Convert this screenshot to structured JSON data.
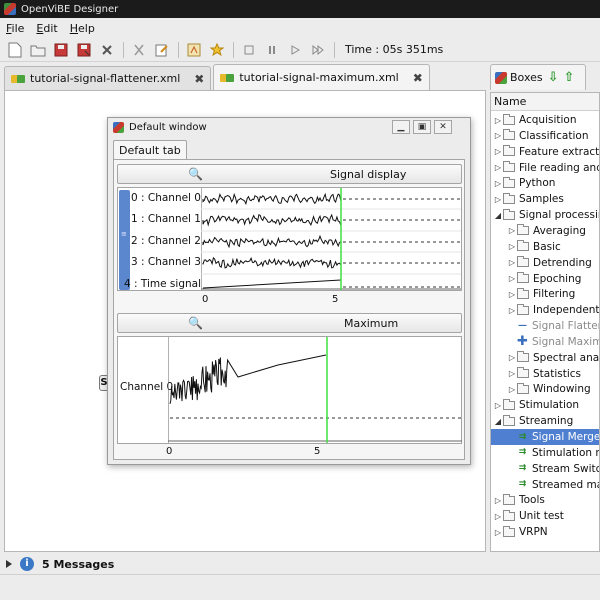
{
  "window": {
    "title": "OpenViBE Designer"
  },
  "menu": [
    "File",
    "Edit",
    "Help"
  ],
  "toolbar": {
    "time_label": "Time : 05s 351ms"
  },
  "tabs": [
    {
      "label": "tutorial-signal-flattener.xml",
      "active": false
    },
    {
      "label": "tutorial-signal-maximum.xml",
      "active": true
    }
  ],
  "canvas": {
    "box_stub_label": "S"
  },
  "status": {
    "messages": "5 Messages"
  },
  "boxes_panel": {
    "tab_label": "Boxes",
    "column_header": "Name",
    "items": [
      {
        "label": "Acquisition",
        "level": 0,
        "kind": "folder",
        "expanded": false
      },
      {
        "label": "Classification",
        "level": 0,
        "kind": "folder",
        "expanded": false
      },
      {
        "label": "Feature extraction",
        "level": 0,
        "kind": "folder",
        "expanded": false
      },
      {
        "label": "File reading and",
        "level": 0,
        "kind": "folder",
        "expanded": false
      },
      {
        "label": "Python",
        "level": 0,
        "kind": "folder",
        "expanded": false
      },
      {
        "label": "Samples",
        "level": 0,
        "kind": "folder",
        "expanded": false
      },
      {
        "label": "Signal processing",
        "level": 0,
        "kind": "folder",
        "expanded": true
      },
      {
        "label": "Averaging",
        "level": 1,
        "kind": "folder",
        "expanded": false
      },
      {
        "label": "Basic",
        "level": 1,
        "kind": "folder",
        "expanded": false
      },
      {
        "label": "Detrending",
        "level": 1,
        "kind": "folder",
        "expanded": false
      },
      {
        "label": "Epoching",
        "level": 1,
        "kind": "folder",
        "expanded": false
      },
      {
        "label": "Filtering",
        "level": 1,
        "kind": "folder",
        "expanded": false
      },
      {
        "label": "Independent c",
        "level": 1,
        "kind": "folder",
        "expanded": false
      },
      {
        "label": "Signal Flatten",
        "level": 1,
        "kind": "box-line",
        "grey": true
      },
      {
        "label": "Signal Maximu",
        "level": 1,
        "kind": "box-plus",
        "grey": true
      },
      {
        "label": "Spectral analy",
        "level": 1,
        "kind": "folder",
        "expanded": false
      },
      {
        "label": "Statistics",
        "level": 1,
        "kind": "folder",
        "expanded": false
      },
      {
        "label": "Windowing",
        "level": 1,
        "kind": "folder",
        "expanded": false
      },
      {
        "label": "Stimulation",
        "level": 0,
        "kind": "folder",
        "expanded": false
      },
      {
        "label": "Streaming",
        "level": 0,
        "kind": "folder",
        "expanded": true
      },
      {
        "label": "Signal Merger",
        "level": 1,
        "kind": "box",
        "selected": true
      },
      {
        "label": "Stimulation m",
        "level": 1,
        "kind": "box"
      },
      {
        "label": "Stream Switch",
        "level": 1,
        "kind": "box"
      },
      {
        "label": "Streamed ma",
        "level": 1,
        "kind": "box"
      },
      {
        "label": "Tools",
        "level": 0,
        "kind": "folder",
        "expanded": false
      },
      {
        "label": "Unit test",
        "level": 0,
        "kind": "folder",
        "expanded": false
      },
      {
        "label": "VRPN",
        "level": 0,
        "kind": "folder",
        "expanded": false
      }
    ]
  },
  "default_window": {
    "title": "Default window",
    "tab_label": "Default tab",
    "signal_display": {
      "header": "Signal display",
      "channels": [
        "0 : Channel 0",
        "1 : Channel 1",
        "2 : Channel 2",
        "3 : Channel 3",
        "4 : Time signal"
      ],
      "x_ticks": [
        "0",
        "5"
      ]
    },
    "maximum": {
      "header": "Maximum",
      "channel_label": "Channel 0",
      "x_ticks": [
        "0",
        "5"
      ]
    }
  },
  "colors": {
    "cursor": "#3ee03e",
    "selection": "#4f7fd0",
    "scrollbar": "#5b87cf"
  }
}
